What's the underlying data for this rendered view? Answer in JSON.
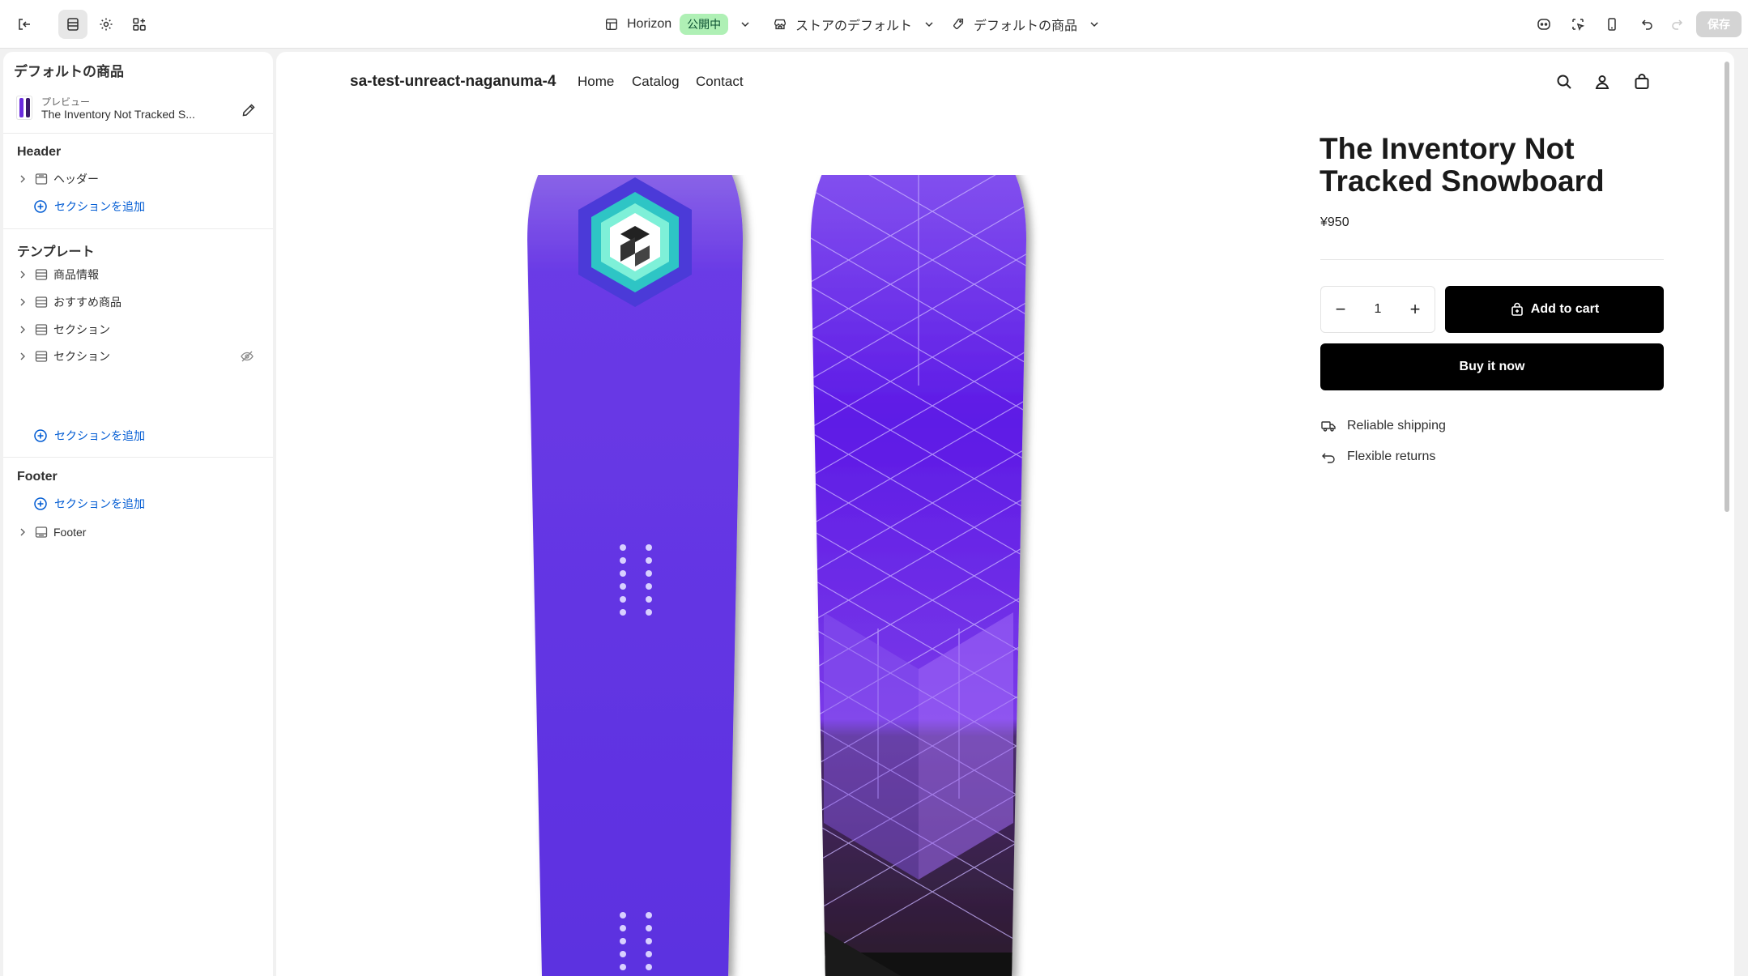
{
  "topbar": {
    "exit_icon": "exit-icon",
    "theme_name": "Horizon",
    "theme_status": "公開中",
    "store_selector": "ストアのデフォルト",
    "template_selector": "デフォルトの商品",
    "save_label": "保存"
  },
  "sidebar": {
    "title": "デフォルトの商品",
    "preview_label": "プレビュー",
    "preview_name": "The Inventory Not Tracked S...",
    "groups": {
      "header": {
        "title": "Header",
        "items": [
          "ヘッダー"
        ],
        "add_label": "セクションを追加"
      },
      "template": {
        "title": "テンプレート",
        "items": [
          "商品情報",
          "おすすめ商品",
          "セクション",
          "セクション"
        ],
        "add_label": "セクションを追加"
      },
      "footer": {
        "title": "Footer",
        "add_label": "セクションを追加",
        "items": [
          "Footer"
        ]
      }
    }
  },
  "store": {
    "name": "sa-test-unreact-naganuma-4",
    "nav": [
      "Home",
      "Catalog",
      "Contact"
    ]
  },
  "product": {
    "title": "The Inventory Not Tracked Snowboard",
    "price": "¥950",
    "quantity": "1",
    "add_to_cart": "Add to cart",
    "buy_now": "Buy it now",
    "features": [
      "Reliable shipping",
      "Flexible returns"
    ]
  },
  "colors": {
    "accent_link": "#005bd3",
    "live_badge_bg": "#aff0b5",
    "board_purple": "#5b2be0",
    "button_black": "#000000"
  }
}
